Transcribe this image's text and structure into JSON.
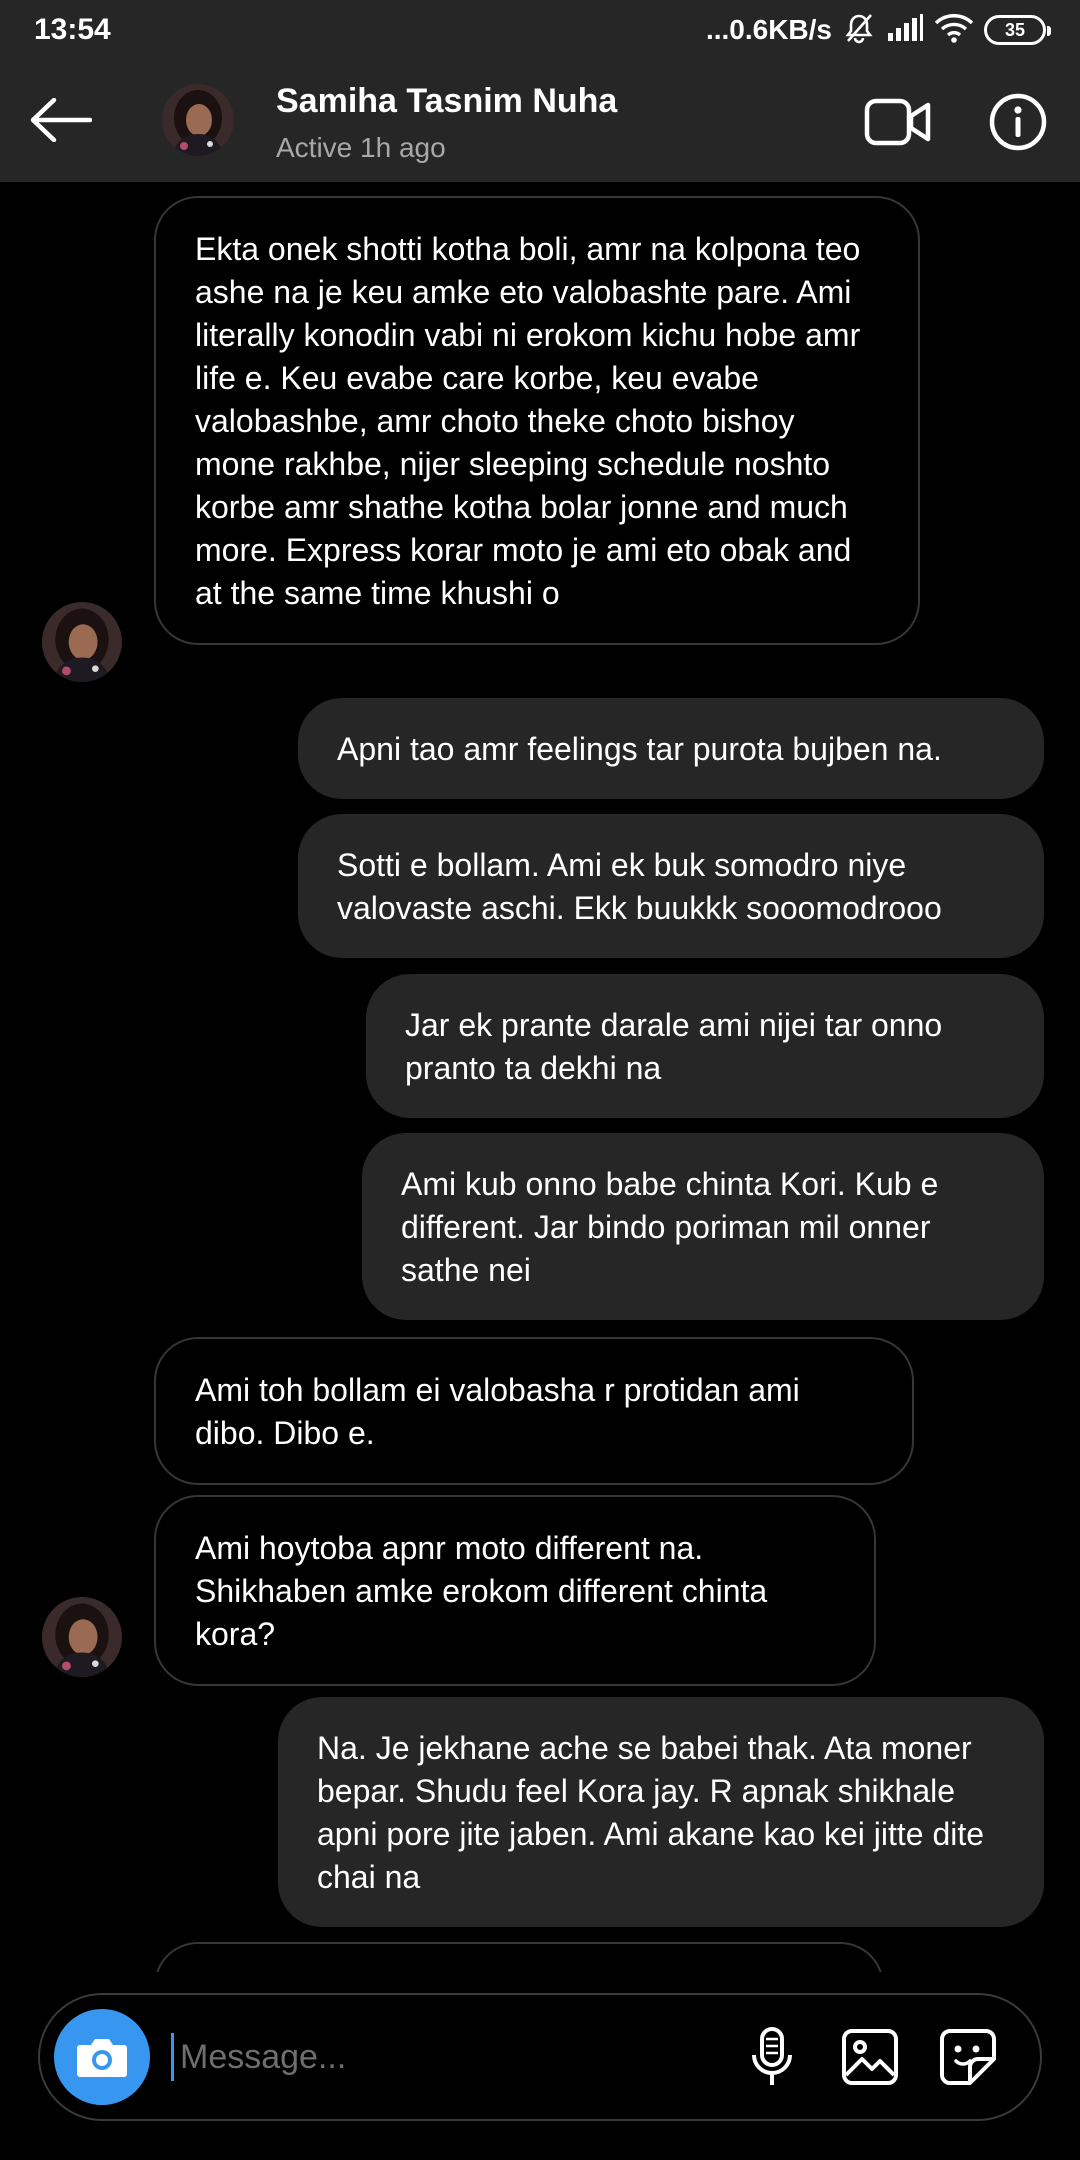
{
  "status_bar": {
    "time": "13:54",
    "network_speed": "...0.6KB/s",
    "battery": "35",
    "icons": [
      "mute-icon",
      "signal-icon",
      "wifi-icon",
      "battery-icon"
    ]
  },
  "header": {
    "name": "Samiha Tasnim Nuha",
    "status": "Active 1h ago",
    "icons": [
      "back-arrow-icon",
      "video-call-icon",
      "info-icon"
    ]
  },
  "messages": [
    {
      "from": "them",
      "text": "Ekta onek shotti kotha boli, amr na kolpona teo ashe na je keu amke eto valobashte pare. Ami literally konodin vabi ni erokom kichu hobe amr life e. Keu evabe care korbe, keu evabe valobashbe, amr choto theke choto bishoy mone rakhbe, nijer sleeping schedule noshto korbe amr shathe kotha bolar jonne and much more. Express korar moto je ami eto obak and at the same time khushi o"
    },
    {
      "from": "me",
      "text": "Apni tao amr feelings tar purota bujben na."
    },
    {
      "from": "me",
      "text": "Sotti e bollam. Ami ek buk somodro niye valovaste aschi. Ekk buukkk sooomodrooo"
    },
    {
      "from": "me",
      "text": "Jar ek prante darale ami nijei tar onno pranto ta dekhi na"
    },
    {
      "from": "me",
      "text": "Ami kub onno babe chinta Kori. Kub e different. Jar bindo poriman mil onner sathe nei"
    },
    {
      "from": "them",
      "text": "Ami toh bollam ei valobasha r protidan ami dibo. Dibo e."
    },
    {
      "from": "them",
      "text": "Ami hoytoba apnr moto different na. Shikhaben amke erokom different chinta kora?"
    },
    {
      "from": "me",
      "text": "Na. Je jekhane ache se babei thak. Ata moner bepar. Shudu feel Kora jay. R apnak shikhale apni pore jite jaben. Ami akane kao kei jitte dite chai na"
    }
  ],
  "composer": {
    "placeholder": "Message...",
    "icons": [
      "camera-icon",
      "microphone-icon",
      "gallery-icon",
      "sticker-icon"
    ]
  },
  "colors": {
    "background": "#000000",
    "bar": "#262626",
    "outgoing_bubble": "#262626",
    "incoming_border": "#363636",
    "accent": "#3797f0",
    "muted_text": "#a8a8a8"
  }
}
